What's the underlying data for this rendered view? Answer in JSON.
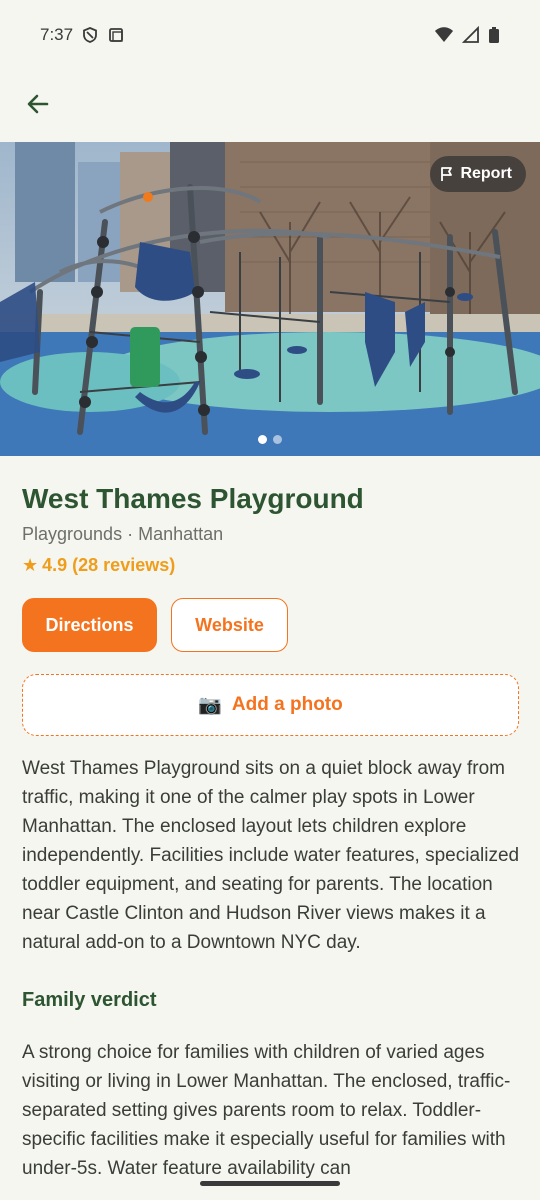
{
  "status": {
    "time": "7:37"
  },
  "place": {
    "title": "West Thames Playground",
    "category": "Playgrounds",
    "separator": "·",
    "borough": "Manhattan",
    "rating_star": "★",
    "rating_text": "4.9 (28 reviews)"
  },
  "hero": {
    "report_label": "Report",
    "pages": 2,
    "active_page": 1
  },
  "actions": {
    "directions_label": "Directions",
    "website_label": "Website"
  },
  "add_photo": {
    "icon": "📷",
    "label": "Add a photo"
  },
  "description": "West Thames Playground sits on a quiet block away from traffic, making it one of the calmer play spots in Lower Manhattan. The enclosed layout lets children explore independently. Facilities include water features, specialized toddler equipment, and seating for parents. The location near Castle Clinton and Hudson River views makes it a natural add-on to a Downtown NYC day.",
  "verdict": {
    "heading": "Family verdict",
    "text": "A strong choice for families with children of varied ages visiting or living in Lower Manhattan. The enclosed, traffic-separated setting gives parents room to relax. Toddler-specific facilities make it especially useful for families with under-5s. Water feature availability can"
  },
  "colors": {
    "accent": "#f4731f",
    "title_green": "#2e5532",
    "rating": "#ef9d1c",
    "background": "#f5f6ef"
  }
}
